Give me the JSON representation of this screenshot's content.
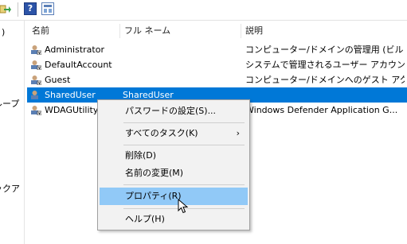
{
  "toolbar": {
    "icons": [
      "export-arrow-icon",
      "help-icon",
      "view-icon"
    ],
    "help_glyph": "?"
  },
  "left_pane": {
    "fragments": [
      ")",
      "ループ",
      "ックア"
    ]
  },
  "columns": [
    "名前",
    "フル ネーム",
    "説明"
  ],
  "rows": [
    {
      "name": "Administrator",
      "full_name": "",
      "description": "コンピューター/ドメインの管理用 (ビルト..."
    },
    {
      "name": "DefaultAccount",
      "full_name": "",
      "description": "システムで管理されるユーザー アカウン..."
    },
    {
      "name": "Guest",
      "full_name": "",
      "description": "コンピューター/ドメインへのゲスト アクセ..."
    },
    {
      "name": "SharedUser",
      "full_name": "SharedUser",
      "description": ""
    },
    {
      "name": "WDAGUtility",
      "full_name": "",
      "description": "Windows Defender Application G..."
    }
  ],
  "selected_row": 3,
  "context_menu": {
    "items": [
      {
        "label": "パスワードの設定(S)..."
      },
      {
        "label": "すべてのタスク(K)",
        "submenu_arrow": "›"
      },
      {
        "label": "削除(D)"
      },
      {
        "label": "名前の変更(M)"
      },
      {
        "label": "プロパティ(R)",
        "highlighted": true
      },
      {
        "label": "ヘルプ(H)"
      }
    ]
  },
  "colors": {
    "selection": "#0078d7",
    "menu_highlight": "#91c9f7",
    "menu_bg": "#f2f2f2"
  }
}
